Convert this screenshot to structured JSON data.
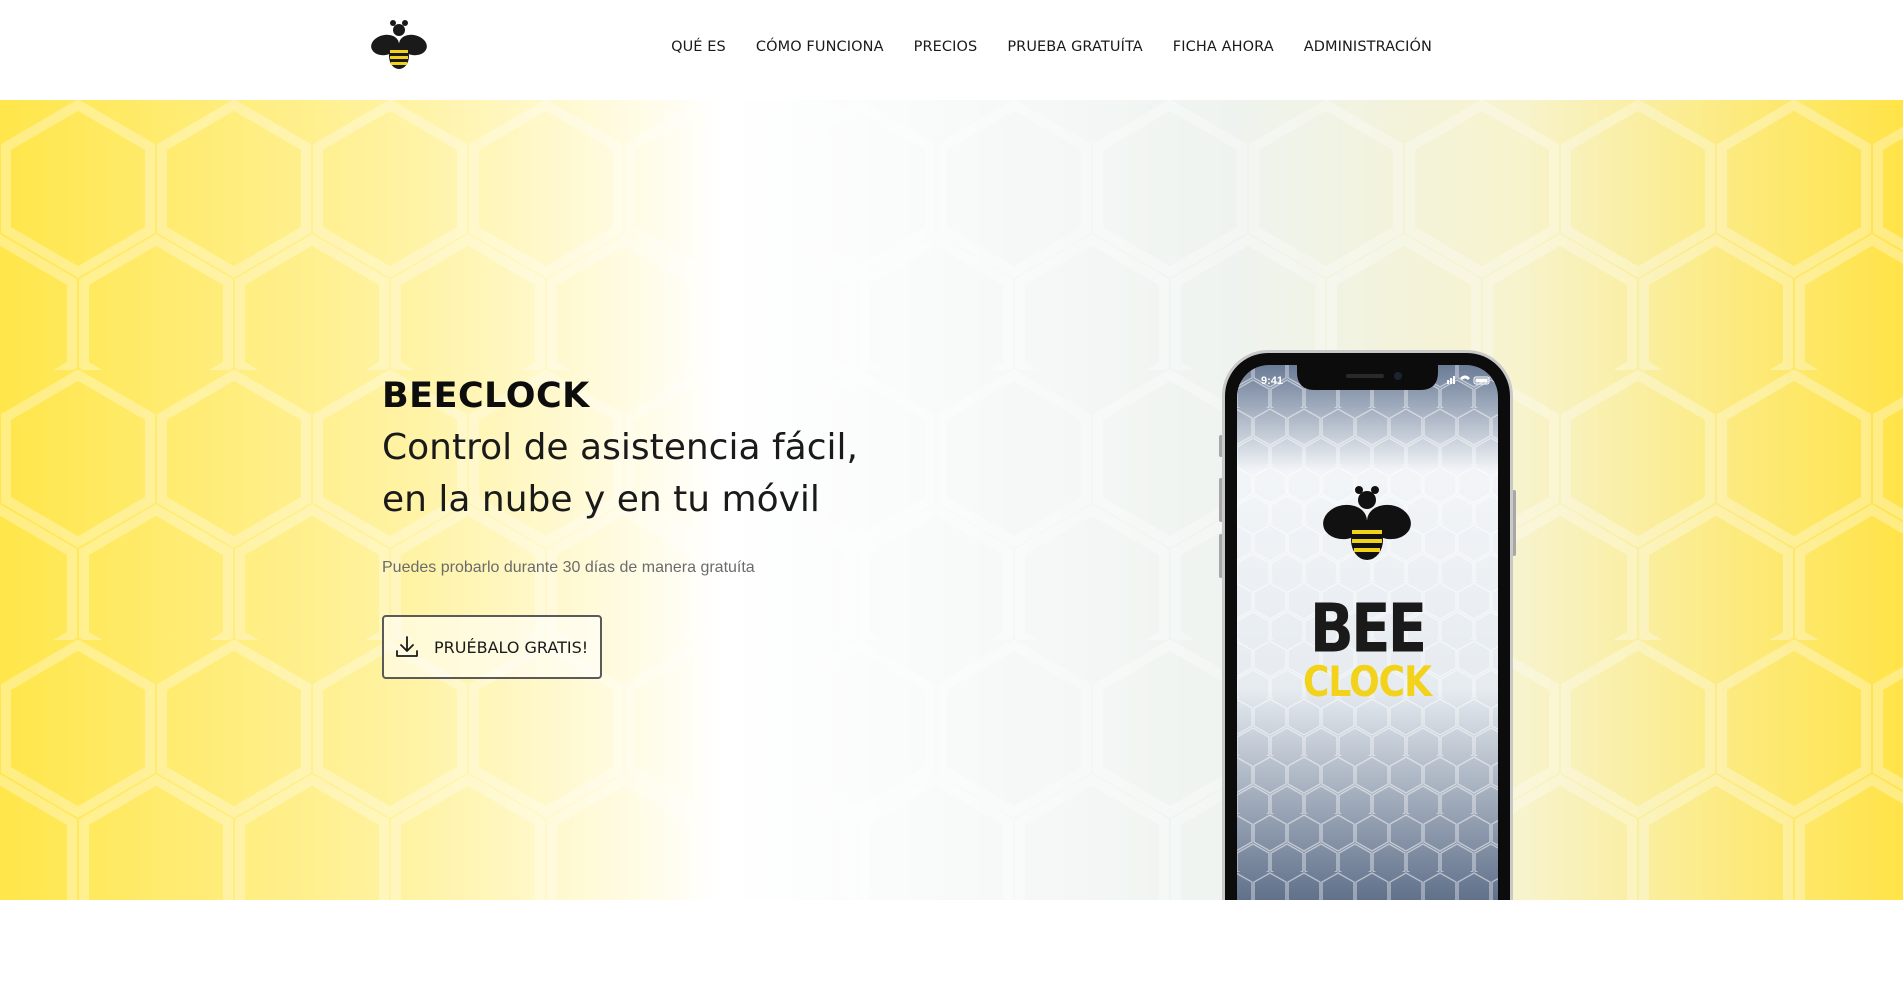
{
  "header": {
    "logo_icon": "bee-logo-icon",
    "nav": [
      {
        "label": "QUÉ ES"
      },
      {
        "label": "CÓMO FUNCIONA"
      },
      {
        "label": "PRECIOS"
      },
      {
        "label": "PRUEBA GRATUÍTA"
      },
      {
        "label": "FICHA AHORA"
      },
      {
        "label": "ADMINISTRACIÓN"
      }
    ]
  },
  "hero": {
    "brand": "BEECLOCK",
    "tagline_line1": "Control de asistencia fácil,",
    "tagline_line2": "en la nube y en tu móvil",
    "subtitle": "Puedes probarlo durante 30 días de manera gratuíta",
    "cta": {
      "label": "PRUÉBALO GRATIS!",
      "icon": "download-icon"
    }
  },
  "phone": {
    "status_time": "9:41",
    "app_logo_top": "BEE",
    "app_logo_bottom": "CLOCK"
  },
  "colors": {
    "accent_yellow": "#ffe64a",
    "logo_yellow": "#f2d21a",
    "dark": "#111111"
  }
}
